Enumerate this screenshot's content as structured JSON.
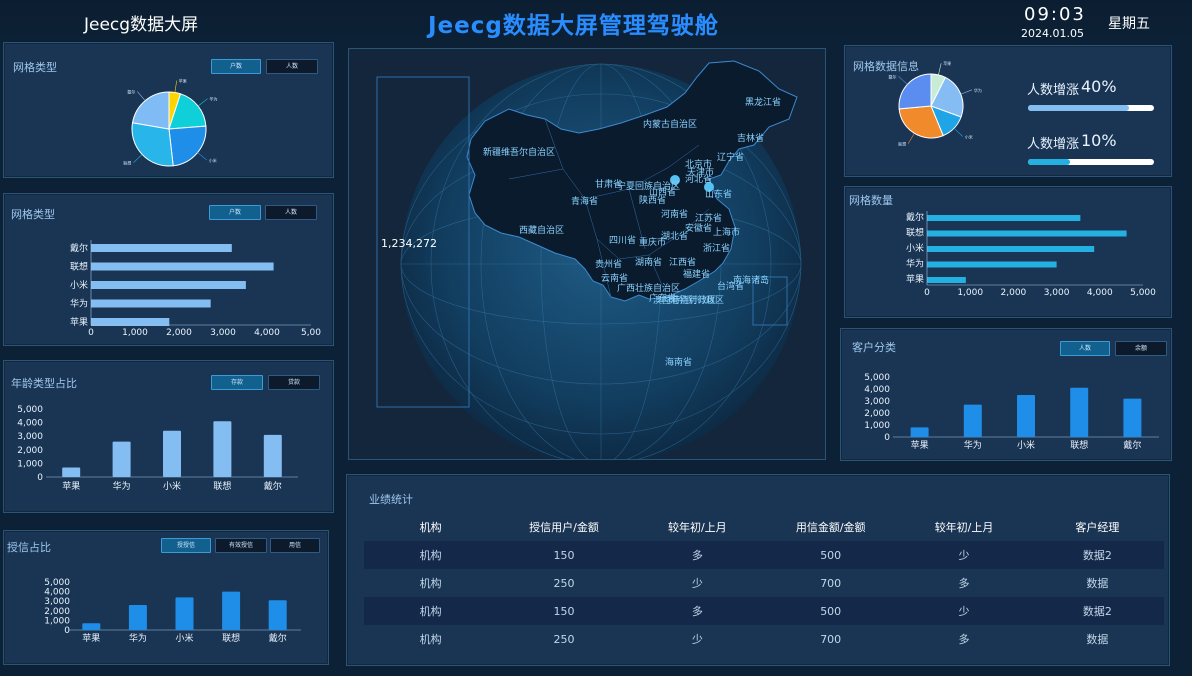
{
  "header": {
    "left_title": "Jeecg数据大屏",
    "main_title": "Jeecg数据大屏管理驾驶舱",
    "time": "09:03",
    "date": "2024.01.05",
    "weekday": "星期五"
  },
  "panel_grid_type_pie": {
    "title": "网格类型",
    "tabs": [
      "户数",
      "人数"
    ],
    "active_tab": 0,
    "slice_labels": [
      "苹果",
      "华为",
      "小米",
      "联想",
      "戴尔"
    ]
  },
  "panel_grid_type_bar": {
    "title": "网格类型",
    "tabs": [
      "户数",
      "人数"
    ],
    "active_tab": 0
  },
  "panel_age": {
    "title": "年龄类型占比",
    "tabs": [
      "存款",
      "贷款"
    ],
    "active_tab": 0
  },
  "panel_credit": {
    "title": "授信占比",
    "tabs": [
      "授授信",
      "有效授信",
      "用信"
    ],
    "active_tab": 0
  },
  "map": {
    "total": "1,234,272",
    "provinces": [
      "黑龙江省",
      "内蒙古自治区",
      "吉林省",
      "新疆维吾尔自治区",
      "辽宁省",
      "北京市",
      "天津市",
      "河北省",
      "甘肃省",
      "宁夏回族自治区",
      "山西省",
      "山东省",
      "青海省",
      "陕西省",
      "河南省",
      "江苏省",
      "西藏自治区",
      "安徽省",
      "上海市",
      "四川省",
      "重庆市",
      "湖北省",
      "浙江省",
      "贵州省",
      "湖南省",
      "江西省",
      "福建省",
      "云南省",
      "台湾省",
      "广西壮族自治区",
      "广东省",
      "香港特别行政区",
      "澳门特别行政区",
      "南海诸岛",
      "海南省"
    ]
  },
  "panel_grid_info": {
    "title": "网格数据信息",
    "stat1_label": "人数增涨",
    "stat1_value": "40%",
    "stat1_fraction": 0.8,
    "stat2_label": "人数增涨",
    "stat2_value": "10%",
    "stat2_fraction": 0.33,
    "slice_labels": [
      "苹果",
      "华为",
      "小米",
      "联想",
      "戴尔"
    ]
  },
  "panel_grid_count": {
    "title": "网格数量"
  },
  "panel_customer": {
    "title": "客户分类",
    "tabs": [
      "人数",
      "余额"
    ],
    "active_tab": 0
  },
  "table": {
    "title": "业绩统计",
    "columns": [
      "机构",
      "授信用户/金额",
      "较年初/上月",
      "用信金额/金额",
      "较年初/上月",
      "客户经理"
    ],
    "rows": [
      [
        "机构",
        "150",
        "多",
        "500",
        "少",
        "数据2"
      ],
      [
        "机构",
        "250",
        "少",
        "700",
        "多",
        "数据"
      ],
      [
        "机构",
        "150",
        "多",
        "500",
        "少",
        "数据2"
      ],
      [
        "机构",
        "250",
        "少",
        "700",
        "多",
        "数据"
      ]
    ]
  },
  "chart_data": [
    {
      "id": "pie_grid_type",
      "type": "pie",
      "categories": [
        "苹果",
        "华为",
        "小米",
        "联想",
        "戴尔"
      ],
      "values": [
        700,
        2600,
        3400,
        4100,
        3100
      ],
      "colors": [
        "#ffd400",
        "#0fd0d8",
        "#1e8ee8",
        "#27b5ea",
        "#7fbcf5"
      ]
    },
    {
      "id": "hbar_grid_type",
      "type": "bar",
      "orientation": "horizontal",
      "categories": [
        "戴尔",
        "联想",
        "小米",
        "华为",
        "苹果"
      ],
      "values": [
        3200,
        4150,
        3520,
        2720,
        1780
      ],
      "xlim": [
        0,
        5000
      ],
      "xticks": [
        "0",
        "1,000",
        "2,000",
        "3,000",
        "4,000",
        "5,00"
      ],
      "color": "#84bdf2"
    },
    {
      "id": "vbar_age",
      "type": "bar",
      "categories": [
        "苹果",
        "华为",
        "小米",
        "联想",
        "戴尔"
      ],
      "values": [
        700,
        2600,
        3400,
        4100,
        3100
      ],
      "ylim": [
        0,
        5000
      ],
      "yticks": [
        "0",
        "1,000",
        "2,000",
        "3,000",
        "4,000",
        "5,000"
      ],
      "color": "#84bdf2"
    },
    {
      "id": "vbar_credit",
      "type": "bar",
      "categories": [
        "苹果",
        "华为",
        "小米",
        "联想",
        "戴尔"
      ],
      "values": [
        700,
        2600,
        3400,
        4000,
        3100
      ],
      "ylim": [
        0,
        5000
      ],
      "yticks": [
        "0",
        "1,000",
        "2,000",
        "3,000",
        "4,000",
        "5,000"
      ],
      "color": "#1e8ee8"
    },
    {
      "id": "pie_grid_info",
      "type": "pie",
      "categories": [
        "苹果",
        "华为",
        "小米",
        "联想",
        "戴尔"
      ],
      "values": [
        900,
        2800,
        1600,
        3600,
        3200
      ],
      "colors": [
        "#c8ecd6",
        "#85bcf4",
        "#1fa4e5",
        "#f08a2a",
        "#5b8cf0"
      ]
    },
    {
      "id": "hbar_grid_count",
      "type": "bar",
      "orientation": "horizontal",
      "categories": [
        "戴尔",
        "联想",
        "小米",
        "华为",
        "苹果"
      ],
      "values": [
        3550,
        4620,
        3870,
        3000,
        900
      ],
      "xlim": [
        0,
        5000
      ],
      "xticks": [
        "0",
        "1,000",
        "2,000",
        "3,000",
        "4,000",
        "5,000"
      ],
      "color": "#24b0e0"
    },
    {
      "id": "vbar_customer",
      "type": "bar",
      "categories": [
        "苹果",
        "华为",
        "小米",
        "联想",
        "戴尔"
      ],
      "values": [
        800,
        2700,
        3500,
        4100,
        3200
      ],
      "ylim": [
        0,
        5000
      ],
      "yticks": [
        "0",
        "1,000",
        "2,000",
        "3,000",
        "4,000",
        "5,000"
      ],
      "color": "#1e8ee8"
    }
  ]
}
